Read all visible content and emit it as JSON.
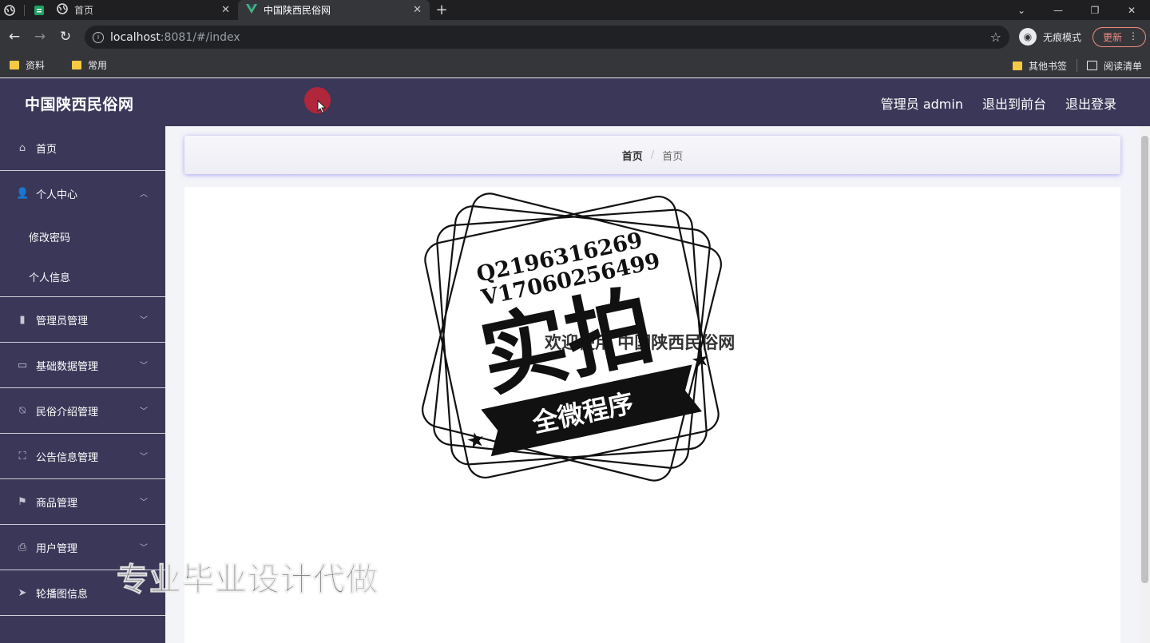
{
  "browser": {
    "tabs": [
      {
        "title": "首页",
        "active": false
      },
      {
        "title": "中国陕西民俗网",
        "active": true
      }
    ],
    "url_host": "localhost",
    "url_rest": ":8081/#/index",
    "incognito_label": "无痕模式",
    "update_label": "更新",
    "bookmarks": [
      "资料",
      "常用"
    ],
    "bookmarks_right": [
      "其他书签",
      "阅读清单"
    ]
  },
  "header": {
    "brand": "中国陕西民俗网",
    "admin_label": "管理员 admin",
    "to_front": "退出到前台",
    "logout": "退出登录"
  },
  "sidebar": {
    "items": [
      {
        "label": "首页",
        "icon": "home-icon"
      },
      {
        "label": "个人中心",
        "icon": "user-icon",
        "expanded": true,
        "children": [
          "修改密码",
          "个人信息"
        ]
      },
      {
        "label": "管理员管理",
        "icon": "bar-chart-icon"
      },
      {
        "label": "基础数据管理",
        "icon": "card-icon"
      },
      {
        "label": "民俗介绍管理",
        "icon": "bell-off-icon"
      },
      {
        "label": "公告信息管理",
        "icon": "frame-icon"
      },
      {
        "label": "商品管理",
        "icon": "flag-icon"
      },
      {
        "label": "用户管理",
        "icon": "printer-icon"
      },
      {
        "label": "轮播图信息",
        "icon": "send-icon"
      }
    ]
  },
  "breadcrumb": {
    "root": "首页",
    "current": "首页"
  },
  "main": {
    "welcome": "欢迎使用 中国陕西民俗网"
  },
  "overlay": {
    "stamp_line1": "Q2196316269",
    "stamp_line2": "V17060256499",
    "stamp_big": "实拍",
    "stamp_banner": "全微程序",
    "watermark": "专业毕业设计代做"
  },
  "colors": {
    "header_bg": "#3a3758",
    "sidebar_bg": "#3a3758",
    "accent_shadow": "#6c63f0"
  }
}
